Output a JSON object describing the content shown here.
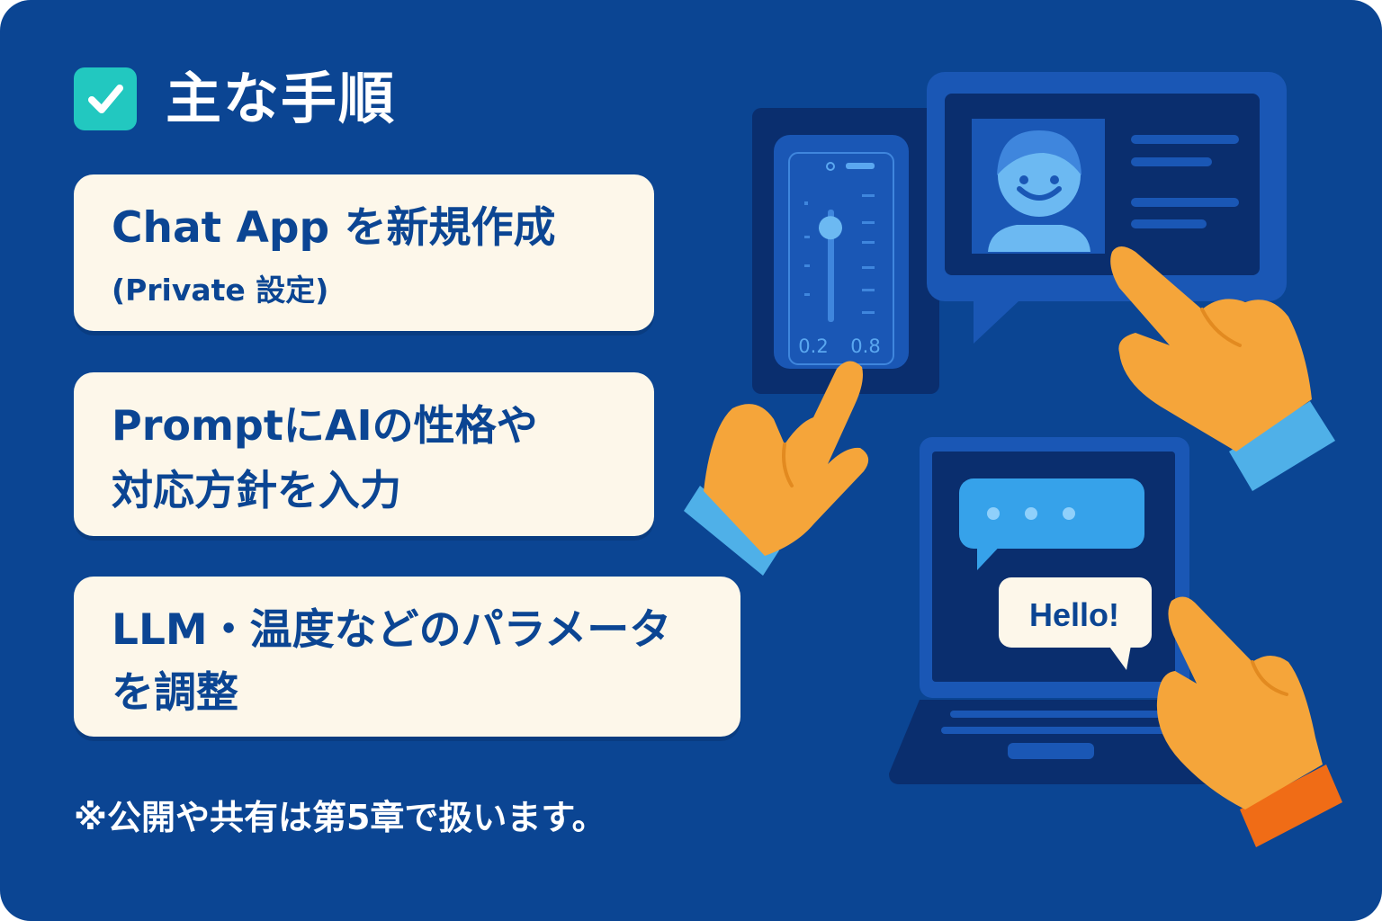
{
  "header": {
    "icon": "checkbox-checked-icon",
    "title": "主な手順"
  },
  "steps": [
    {
      "lines": [
        "Chat App を新規作成",
        "(Private 設定)"
      ]
    },
    {
      "lines": [
        "PromptにAIの性格や",
        "対応方針を入力"
      ]
    },
    {
      "lines": [
        "LLM・温度などのパラメータ",
        "を調整"
      ]
    }
  ],
  "footnote": "※公開や共有は第5章で扱います。",
  "illustration": {
    "slider_labels": [
      "0.2",
      "0.8"
    ],
    "slider_value": 0.8,
    "chat_bubble_text": "Hello!",
    "icons": [
      "slider-panel-icon",
      "profile-card-icon",
      "user-avatar-icon",
      "laptop-icon",
      "typing-bubble-icon",
      "pointing-hand-icon"
    ]
  },
  "colors": {
    "background": "#0b4593",
    "card": "#fdf7ea",
    "card_text": "#0b4593",
    "accent_check": "#22c8c0",
    "hand": "#f5a53a",
    "sleeve": "#4fb0e8"
  }
}
